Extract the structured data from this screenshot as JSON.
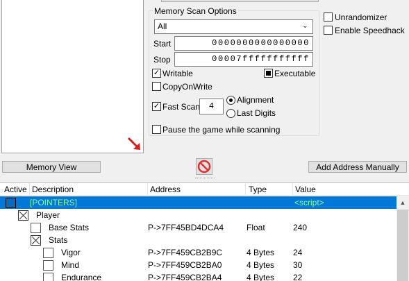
{
  "memory_scan": {
    "group_title": "Memory Scan Options",
    "region_selected": "All",
    "start_label": "Start",
    "start_value": "0000000000000000",
    "stop_label": "Stop",
    "stop_value": "00007fffffffffff",
    "writable_label": "Writable",
    "writable_checked": true,
    "executable_label": "Executable",
    "executable_state": "indeterminate",
    "copyonwrite_label": "CopyOnWrite",
    "copyonwrite_checked": false,
    "fastscan_label": "Fast Scan",
    "fastscan_checked": true,
    "fastscan_value": "4",
    "alignment_label": "Alignment",
    "lastdigits_label": "Last Digits",
    "alignment_mode": "alignment",
    "pause_label": "Pause the game while scanning",
    "pause_checked": false
  },
  "options": {
    "unrandomizer_label": "Unrandomizer",
    "speedhack_label": "Enable Speedhack"
  },
  "buttons": {
    "memory_view": "Memory View",
    "add_address": "Add Address Manually"
  },
  "table": {
    "headers": {
      "active": "Active",
      "description": "Description",
      "address": "Address",
      "type": "Type",
      "value": "Value"
    },
    "rows": [
      {
        "description": "[POINTERS]",
        "address": "",
        "type": "",
        "value": "<script>",
        "selected": true
      },
      {
        "description": "Player",
        "address": "",
        "type": "",
        "value": ""
      },
      {
        "description": "Base Stats",
        "address": "P->7FF45BD4DCA4",
        "type": "Float",
        "value": "240"
      },
      {
        "description": "Stats",
        "address": "",
        "type": "",
        "value": ""
      },
      {
        "description": "Vigor",
        "address": "P->7FF459CB2B9C",
        "type": "4 Bytes",
        "value": "24"
      },
      {
        "description": "Mind",
        "address": "P->7FF459CB2BA0",
        "type": "4 Bytes",
        "value": "30"
      },
      {
        "description": "Endurance",
        "address": "P->7FF459CB2BA4",
        "type": "4 Bytes",
        "value": "22"
      }
    ]
  },
  "colors": {
    "selection": "#0078d7",
    "script_text": "#8fff8f",
    "arrow_red": "#d02020",
    "stop_icon": "#e03030"
  }
}
